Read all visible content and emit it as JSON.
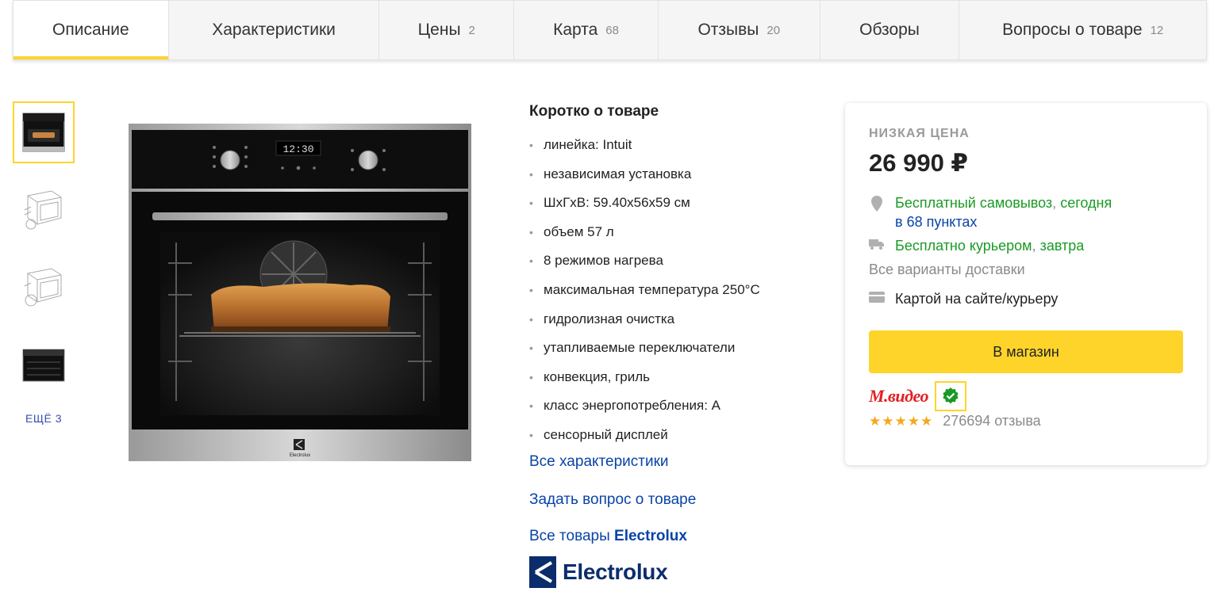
{
  "tabs": [
    {
      "label": "Описание",
      "count": ""
    },
    {
      "label": "Характеристики",
      "count": ""
    },
    {
      "label": "Цены",
      "count": "2"
    },
    {
      "label": "Карта",
      "count": "68"
    },
    {
      "label": "Отзывы",
      "count": "20"
    },
    {
      "label": "Обзоры",
      "count": ""
    },
    {
      "label": "Вопросы о товаре",
      "count": "12"
    }
  ],
  "gallery": {
    "more_label": "ЕЩЁ 3",
    "brand_on_oven": "Electrolux",
    "display_time": "12:30"
  },
  "specs": {
    "title": "Коротко о товаре",
    "items": [
      "линейка: Intuit",
      "независимая установка",
      "ШxГxВ: 59.40x56x59 см",
      "объем 57 л",
      "8 режимов нагрева",
      "максимальная температура 250°C",
      "гидролизная очистка",
      "утапливаемые переключатели",
      "конвекция, гриль",
      "класс энергопотребления: A",
      "сенсорный дисплей"
    ],
    "all_specs_link": "Все характеристики",
    "ask_link": "Задать вопрос о товаре",
    "all_products_prefix": "Все товары",
    "brand": "Electrolux",
    "brand_logo_text": "Electrolux"
  },
  "offer": {
    "label": "НИЗКАЯ ЦЕНА",
    "price": "26 990 ₽",
    "pickup": "Бесплатный самовывоз",
    "pickup_when": "сегодня",
    "pickup_points": "в 68 пунктах",
    "courier": "Бесплатно курьером",
    "courier_when": "завтра",
    "all_delivery": "Все варианты доставки",
    "payment": "Картой на сайте/курьеру",
    "button": "В магазин",
    "shop_name": "М.видео",
    "rating": 5,
    "reviews": "276694 отзыва"
  },
  "colors": {
    "accent": "#fed42b",
    "green": "#1a9a25",
    "link": "#0a43a8",
    "shop": "#e31e24",
    "star": "#f4a91c"
  }
}
